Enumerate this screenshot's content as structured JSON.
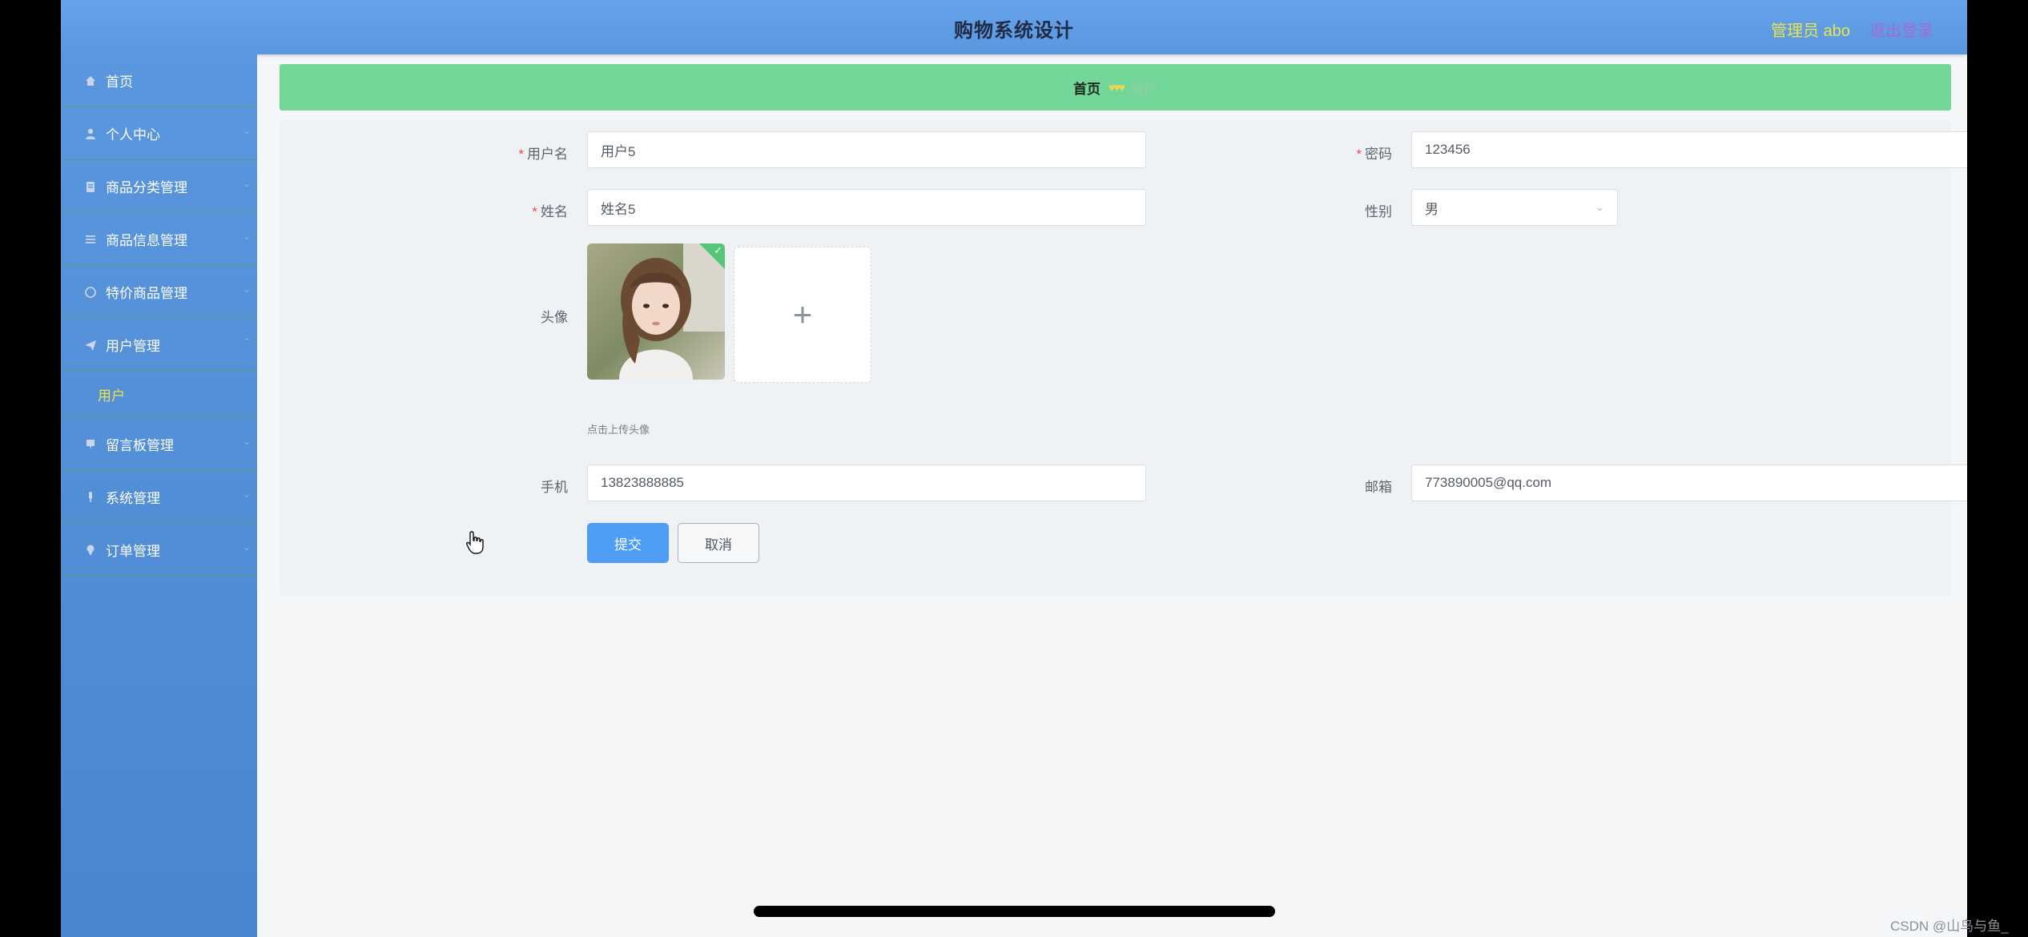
{
  "header": {
    "title": "购物系统设计",
    "admin_label": "管理员 abo",
    "logout_label": "退出登录"
  },
  "sidebar": {
    "items": [
      {
        "label": "首页",
        "icon": "home-icon"
      },
      {
        "label": "个人中心",
        "icon": "user-icon"
      },
      {
        "label": "商品分类管理",
        "icon": "clipboard-icon"
      },
      {
        "label": "商品信息管理",
        "icon": "list-icon"
      },
      {
        "label": "特价商品管理",
        "icon": "circle-icon"
      },
      {
        "label": "用户管理",
        "icon": "send-icon"
      },
      {
        "label": "留言板管理",
        "icon": "message-icon"
      },
      {
        "label": "系统管理",
        "icon": "mic-icon"
      },
      {
        "label": "订单管理",
        "icon": "pin-icon"
      }
    ],
    "sub_item": "用户"
  },
  "breadcrumb": {
    "home": "首页",
    "separator": "♥♥♥",
    "current": "用户"
  },
  "form": {
    "username_label": "用户名",
    "username_value": "用户5",
    "password_label": "密码",
    "password_value": "123456",
    "name_label": "姓名",
    "name_value": "姓名5",
    "gender_label": "性别",
    "gender_value": "男",
    "avatar_label": "头像",
    "avatar_hint": "点击上传头像",
    "phone_label": "手机",
    "phone_value": "13823888885",
    "email_label": "邮箱",
    "email_value": "773890005@qq.com",
    "required_mark": "*",
    "submit_label": "提交",
    "cancel_label": "取消"
  },
  "watermark": "CSDN @山鸟与鱼_",
  "colors": {
    "header": "#5f9ce6",
    "sidebar": "#4f8cd5",
    "breadcrumb": "#74d79a",
    "active_sub": "#e8e44e",
    "primary": "#4f9cf4"
  }
}
